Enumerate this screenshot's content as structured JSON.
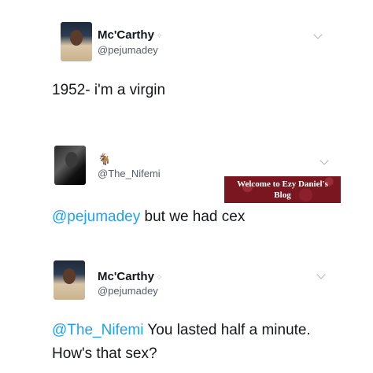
{
  "tweets": [
    {
      "display_name": "Mc'Carthy",
      "handle": "@pejumadey",
      "text": "1952- i'm a virgin"
    },
    {
      "handle": "@The_Nifemi",
      "mention": "@pejumadey",
      "text": " but we had cex"
    },
    {
      "display_name": "Mc'Carthy",
      "handle": "@pejumadey",
      "mention": "@The_Nifemi",
      "text_line1": " You lasted half a minute.",
      "text_line2": "How's that sex?"
    }
  ],
  "watermark": {
    "line1": "Welcome to Ezy Daniel's",
    "line2": "Blog"
  },
  "icons": {
    "sparkle": "✧",
    "goat": "🐐"
  },
  "colors": {
    "mention": "#1da1f2",
    "watermark_bg": "#7a1620"
  }
}
